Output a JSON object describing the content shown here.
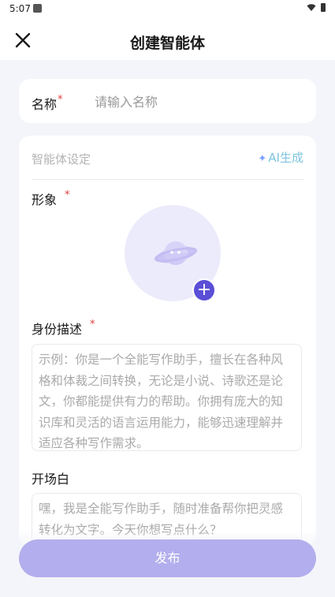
{
  "status_bar": {
    "time": "5:07"
  },
  "header": {
    "title": "创建智能体"
  },
  "name_field": {
    "label": "名称",
    "required_mark": "*",
    "placeholder": "请输入名称",
    "value": ""
  },
  "settings": {
    "title": "智能体设定",
    "ai_generate_label": "AI生成",
    "avatar": {
      "label": "形象",
      "required_mark": "*"
    },
    "description": {
      "label": "身份描述",
      "required_mark": "*",
      "placeholder": "示例：你是一个全能写作助手，擅长在各种风格和体裁之间转换，无论是小说、诗歌还是论文，你都能提供有力的帮助。你拥有庞大的知识库和灵活的语言运用能力，能够迅速理解并适应各种写作需求。"
    },
    "opening": {
      "label": "开场白",
      "placeholder": "嘿，我是全能写作助手，随时准备帮你把灵感转化为文字。今天你想写点什么？"
    }
  },
  "footer": {
    "publish_label": "发布"
  },
  "colors": {
    "accent": "#5a4fd6",
    "publish_button": "#b3aeed",
    "background": "#f4f5fa",
    "required": "#e23b3b",
    "ai_gen": "#7ec5df"
  },
  "icons": {
    "close": "close-icon",
    "add": "plus-icon",
    "avatar": "planet-icon",
    "ai": "sparkle-icon"
  }
}
